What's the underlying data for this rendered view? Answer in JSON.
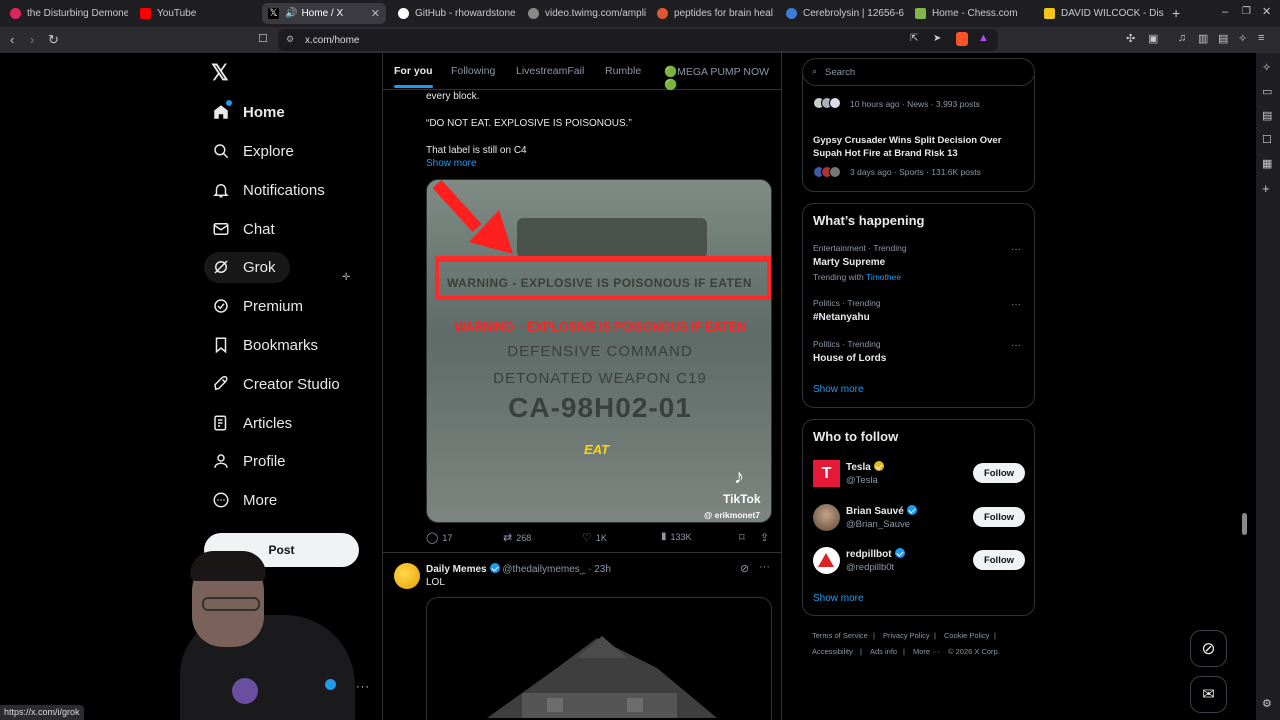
{
  "browser": {
    "tabs": [
      {
        "title": "the Disturbing Demone",
        "favicon_color": "#e0245e"
      },
      {
        "title": "YouTube",
        "favicon_color": "#ff0000"
      },
      {
        "title": "Home / X",
        "favicon_color": "#000000"
      },
      {
        "title": "GitHub - rhowardstone",
        "favicon_color": "#ffffff"
      },
      {
        "title": "video.twimg.com/ampli",
        "favicon_color": "#888888"
      },
      {
        "title": "peptides for brain heal",
        "favicon_color": "#de5833"
      },
      {
        "title": "Cerebrolysin | 12656-6",
        "favicon_color": "#3b7dd8"
      },
      {
        "title": "Home - Chess.com",
        "favicon_color": "#81b64c"
      },
      {
        "title": "DAVID WILCOCK - Disc",
        "favicon_color": "#f5c518"
      }
    ],
    "url": "x.com/home",
    "status_url": "https://x.com/i/grok"
  },
  "sidebar": {
    "items": [
      {
        "label": "Home",
        "icon": "home-icon"
      },
      {
        "label": "Explore",
        "icon": "search-icon"
      },
      {
        "label": "Notifications",
        "icon": "bell-icon"
      },
      {
        "label": "Chat",
        "icon": "mail-icon"
      },
      {
        "label": "Grok",
        "icon": "grok-icon"
      },
      {
        "label": "Premium",
        "icon": "verified-icon"
      },
      {
        "label": "Bookmarks",
        "icon": "bookmark-icon"
      },
      {
        "label": "Creator Studio",
        "icon": "rocket-icon"
      },
      {
        "label": "Articles",
        "icon": "article-icon"
      },
      {
        "label": "Profile",
        "icon": "person-icon"
      },
      {
        "label": "More",
        "icon": "more-icon"
      }
    ],
    "post_label": "Post"
  },
  "feed": {
    "tabs": [
      "For you",
      "Following",
      "LivestreamFail",
      "Rumble",
      "🟢MEGA PUMP NOW🟢"
    ],
    "post1": {
      "line1": "every block.",
      "line2": "“DO NOT EAT. EXPLOSIVE IS POISONOUS.”",
      "line3": "That label is still on C4",
      "show_more": "Show more",
      "media": {
        "warning_label": "WARNING - EXPLOSIVE IS POISONOUS IF EATEN",
        "caption": "WARNING – EXPLOSIVE IS POISONOUS IF EATEN",
        "line_a": "DEFENSIVE COMMAND",
        "line_b": "DETONATED WEAPON C19",
        "line_c": "CA-98H02-01",
        "eat": "EAT",
        "watermark": "TikTok",
        "handle": "@ erikmonet7"
      },
      "replies": "17",
      "reposts": "268",
      "likes": "1K",
      "views": "133K"
    },
    "post2": {
      "name": "Daily Memes",
      "handle": "@thedailymemes_",
      "time": "· 23h",
      "text": "LOL"
    }
  },
  "right": {
    "search_placeholder": "Search",
    "news": [
      {
        "meta": "10 hours ago · News · 3,993 posts"
      },
      {
        "title_l1": "Gypsy Crusader Wins Split Decision Over",
        "title_l2": "Supah Hot Fire at Brand Risk 13",
        "meta": "3 days ago · Sports · 131.6K posts"
      }
    ],
    "whats_happening": {
      "title": "What’s happening",
      "trends": [
        {
          "context": "Entertainment · Trending",
          "name": "Marty Supreme",
          "with_label": "Trending with",
          "with": "Timothee"
        },
        {
          "context": "Politics · Trending",
          "name": "#Netanyahu"
        },
        {
          "context": "Politics · Trending",
          "name": "House of Lords"
        }
      ],
      "show_more": "Show more"
    },
    "who_to_follow": {
      "title": "Who to follow",
      "accounts": [
        {
          "name": "Tesla",
          "handle": "@Tesla",
          "badge": "gold"
        },
        {
          "name": "Brian Sauvé",
          "handle": "@Brian_Sauve",
          "badge": "blue"
        },
        {
          "name": "redpillbot",
          "handle": "@redpillb0t",
          "badge": "blue"
        }
      ],
      "follow_label": "Follow",
      "show_more": "Show more"
    },
    "footer": [
      "Terms of Service",
      "|",
      "Privacy Policy",
      "|",
      "Cookie Policy",
      "|",
      "Accessibility",
      "|",
      "Ads info",
      "|",
      "More ···",
      "© 2026 X Corp."
    ]
  }
}
